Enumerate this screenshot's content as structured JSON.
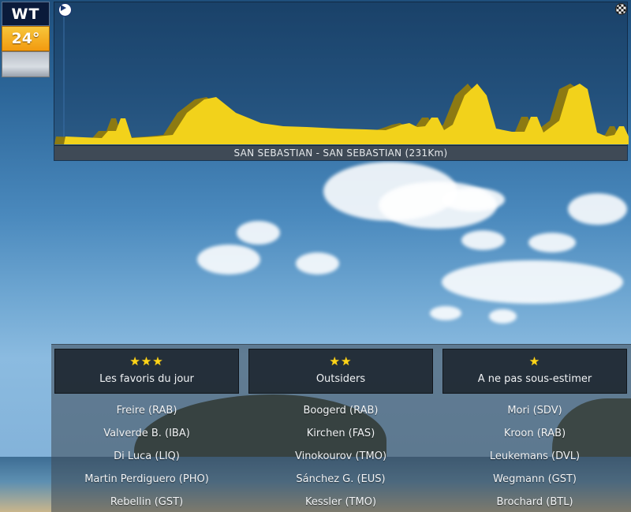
{
  "weather": {
    "code": "WT",
    "temperature": "24°",
    "sky_icon": "overcast-sky-icon"
  },
  "profile": {
    "start_icon": "play-icon",
    "finish_icon": "checkered-flag-icon",
    "route": "SAN SEBASTIAN - SAN SEBASTIAN (231Km)",
    "fill_color": "#f2d21b",
    "shadow_color": "#8d7a12"
  },
  "categories": [
    {
      "stars": "★★★",
      "label": "Les favoris du jour",
      "riders": [
        "Freire (RAB)",
        "Valverde B. (IBA)",
        "Di Luca (LIQ)",
        "Martin Perdiguero (PHO)",
        "Rebellin (GST)"
      ]
    },
    {
      "stars": "★★",
      "label": "Outsiders",
      "riders": [
        "Boogerd (RAB)",
        "Kirchen (FAS)",
        "Vinokourov (TMO)",
        "Sánchez G. (EUS)",
        "Kessler (TMO)"
      ]
    },
    {
      "stars": "★",
      "label": "A ne pas sous-estimer",
      "riders": [
        "Mori (SDV)",
        "Kroon (RAB)",
        "Leukemans (DVL)",
        "Wegmann (GST)",
        "Brochard (BTL)"
      ]
    }
  ]
}
